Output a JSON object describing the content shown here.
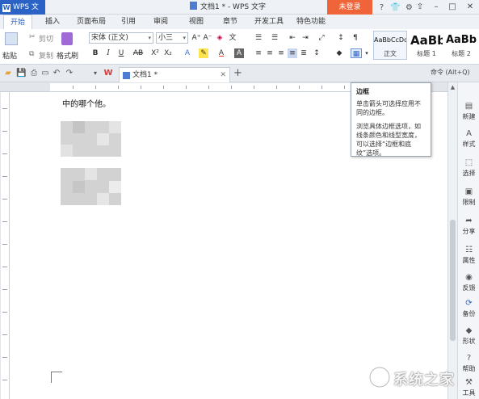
{
  "app": {
    "badge": "WPS 文字",
    "window_title": "文档1 * - WPS 文字",
    "login_label": "未登录"
  },
  "ribbon_tabs": [
    "开始",
    "插入",
    "页面布局",
    "引用",
    "审阅",
    "视图",
    "章节",
    "开发工具",
    "特色功能"
  ],
  "ribbon": {
    "paste_label": "粘贴",
    "cut_label": "剪切",
    "copy_label": "复制",
    "format_painter_label": "格式刷",
    "font_name": "宋体 (正文)",
    "font_size": "小三",
    "styles": [
      {
        "sample": "AaBbCcDd",
        "name": "正文"
      },
      {
        "sample": "AaBb",
        "name": "标题 1"
      },
      {
        "sample": "AaBb",
        "name": "标题 2"
      }
    ]
  },
  "doc_tab": {
    "title": "文档1 *",
    "command_hint": "命令 (Alt+Q)"
  },
  "document": {
    "first_line": "中的哪个他。"
  },
  "tooltip": {
    "title": "边框",
    "line1": "单击箭头可选择应用不同的边框。",
    "line2": "浏览具体边框选项，如线条颜色和线型宽度，可以选择“边框和底纹”选项。"
  },
  "side_panel": [
    "新建",
    "样式",
    "选择",
    "限制",
    "分享",
    "属性",
    "反馈",
    "备份",
    "形状",
    "帮助",
    "工具"
  ],
  "watermark": "系统之家",
  "colors": {
    "accent": "#2b62c5",
    "login": "#f0643a"
  }
}
